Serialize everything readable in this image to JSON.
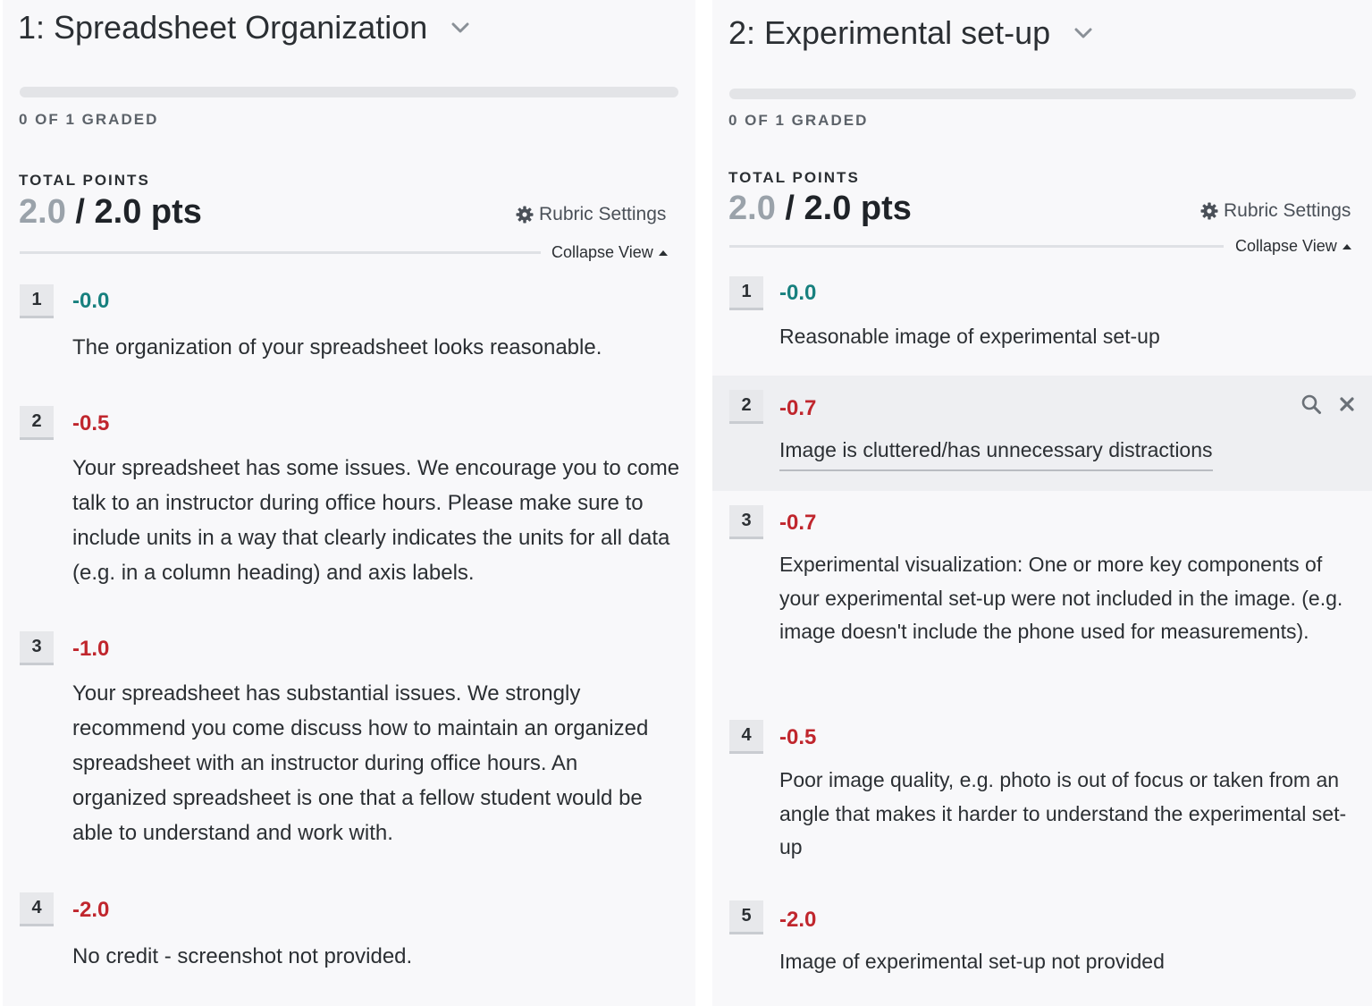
{
  "left": {
    "title": "1: Spreadsheet Organization",
    "graded": "0 OF 1 GRADED",
    "total_label": "TOTAL POINTS",
    "earned": "2.0",
    "separator": " / ",
    "possible": "2.0 pts",
    "rubric_settings": "Rubric Settings",
    "collapse_view": "Collapse View",
    "items": [
      {
        "num": "1",
        "pts": "-0.0",
        "desc": "The organization of your spreadsheet looks reasonable."
      },
      {
        "num": "2",
        "pts": "-0.5",
        "desc": "Your spreadsheet has some issues. We encourage you to come talk to an instructor during office hours. Please make sure to include units in a way that clearly indicates the units for all data (e.g. in a column heading) and axis labels."
      },
      {
        "num": "3",
        "pts": "-1.0",
        "desc": "Your spreadsheet has substantial issues. We strongly recommend you come discuss how to maintain an organized spreadsheet with an instructor during office hours. An organized spreadsheet is one that a fellow student would be able to understand and work with."
      },
      {
        "num": "4",
        "pts": "-2.0",
        "desc": "No credit - screenshot not provided."
      }
    ]
  },
  "right": {
    "title": "2: Experimental set-up",
    "graded": "0 OF 1 GRADED",
    "total_label": "TOTAL POINTS",
    "earned": "2.0",
    "separator": " / ",
    "possible": "2.0 pts",
    "rubric_settings": "Rubric Settings",
    "collapse_view": "Collapse View",
    "items": [
      {
        "num": "1",
        "pts": "-0.0",
        "desc": "Reasonable image of experimental set-up"
      },
      {
        "num": "2",
        "pts": "-0.7",
        "desc": "Image is cluttered/has unnecessary distractions"
      },
      {
        "num": "3",
        "pts": "-0.7",
        "desc": "Experimental visualization: One or more key components of your experimental set-up were not included in the image. (e.g. image doesn't include the phone used for measurements)."
      },
      {
        "num": "4",
        "pts": "-0.5",
        "desc": "Poor image quality, e.g. photo is out of focus or taken from an angle that makes it harder to understand the experimental set-up"
      },
      {
        "num": "5",
        "pts": "-2.0",
        "desc": "Image of experimental set-up not provided"
      }
    ]
  },
  "colors": {
    "zero_points": "#17807e",
    "deduction": "#c0262d",
    "panel_bg": "#f8f8fa",
    "highlight_bg": "#eeeff2"
  },
  "icons": {
    "title_dropdown": "chevron-down-icon",
    "rubric_settings": "gear-icon",
    "collapse": "caret-up-icon",
    "item_search": "search-icon",
    "item_delete": "close-icon"
  }
}
